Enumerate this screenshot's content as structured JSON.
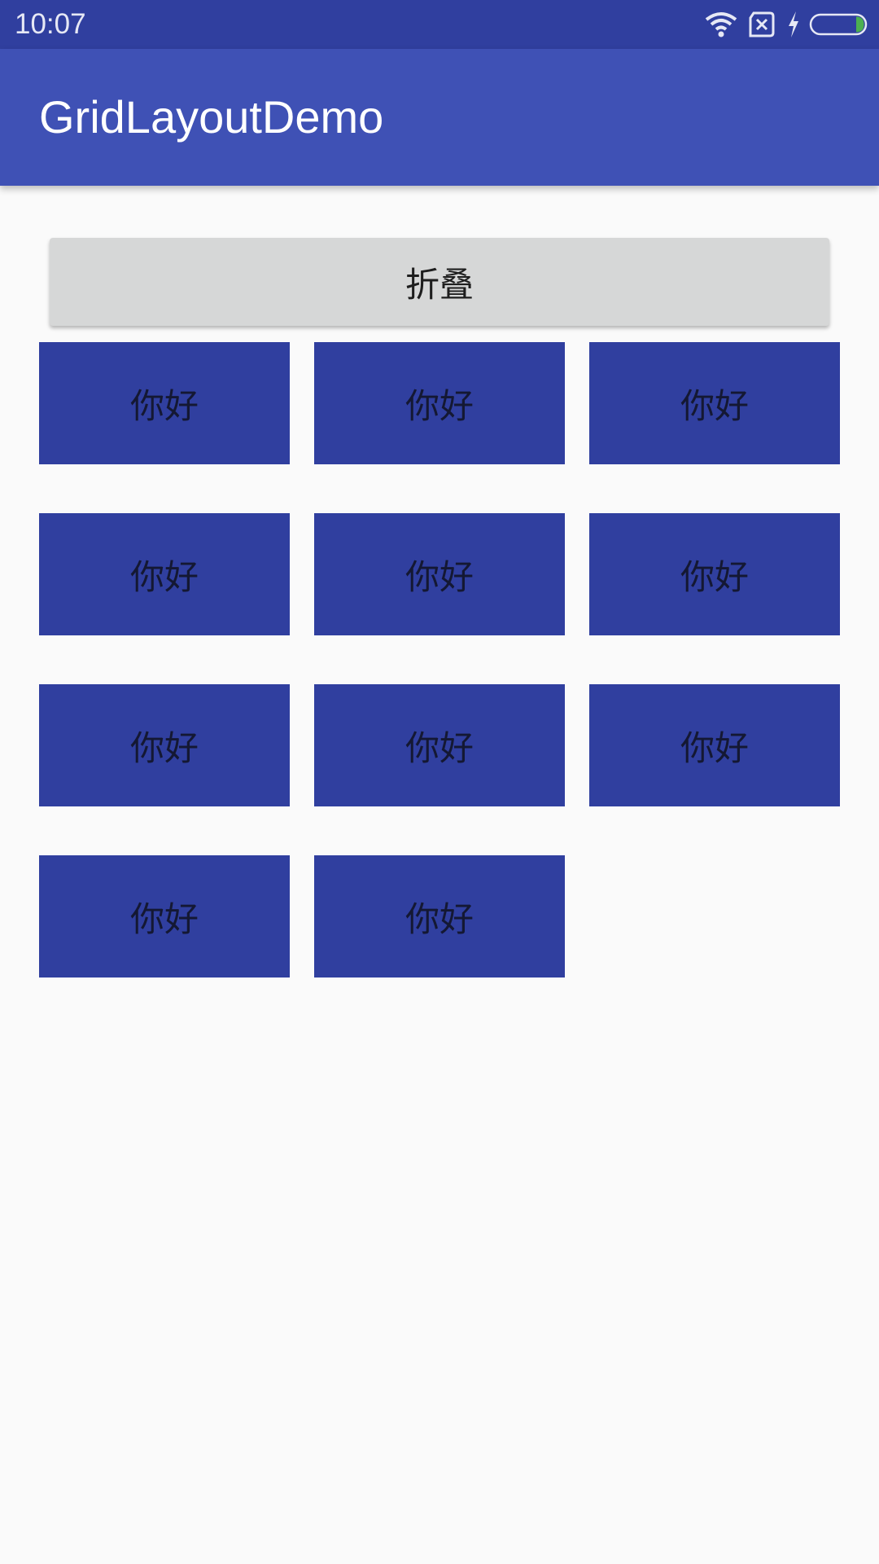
{
  "status_bar": {
    "time": "10:07",
    "icons": [
      "wifi-icon",
      "sim-off-icon",
      "charging-icon",
      "battery-icon"
    ]
  },
  "app_bar": {
    "title": "GridLayoutDemo"
  },
  "fold_button": {
    "label": "折叠"
  },
  "grid": {
    "columns": 3,
    "cells": [
      {
        "label": "你好"
      },
      {
        "label": "你好"
      },
      {
        "label": "你好"
      },
      {
        "label": "你好"
      },
      {
        "label": "你好"
      },
      {
        "label": "你好"
      },
      {
        "label": "你好"
      },
      {
        "label": "你好"
      },
      {
        "label": "你好"
      },
      {
        "label": "你好"
      },
      {
        "label": "你好"
      }
    ]
  },
  "colors": {
    "status_bar": "#303f9f",
    "app_bar": "#3f51b5",
    "grid_cell": "#303f9f",
    "button": "#d6d7d7",
    "background": "#fafafa",
    "battery_level": "#4caf50"
  }
}
